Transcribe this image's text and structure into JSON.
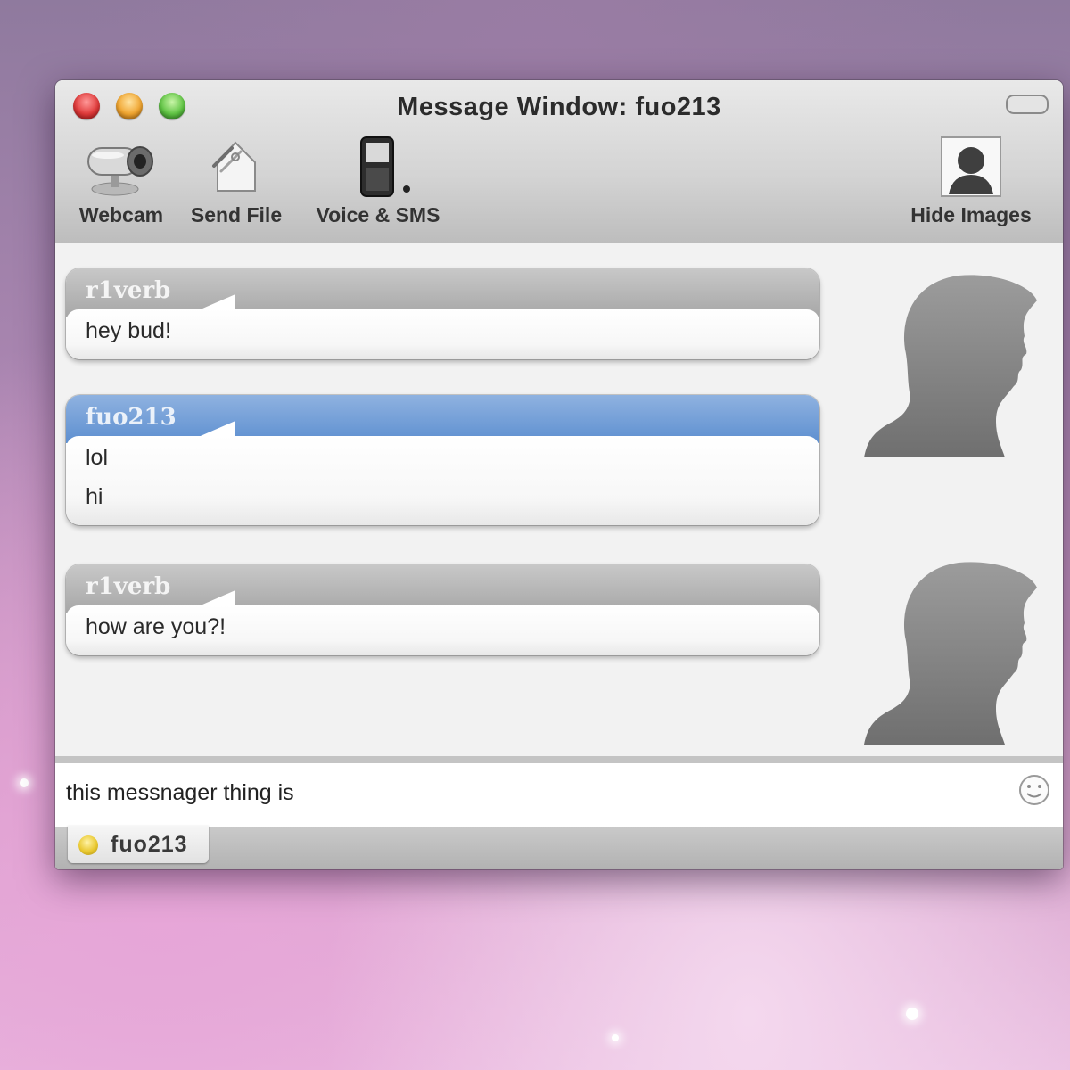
{
  "window": {
    "title": "Message Window: fuo213"
  },
  "toolbar": {
    "webcam": {
      "label": "Webcam",
      "icon": "webcam-icon"
    },
    "send_file": {
      "label": "Send File",
      "icon": "send-file-icon"
    },
    "voice_sms": {
      "label": "Voice & SMS",
      "icon": "phone-icon"
    },
    "hide_images": {
      "label": "Hide Images",
      "icon": "buddy-image-icon"
    }
  },
  "messages": [
    {
      "sender": "r1verb",
      "style": "gray",
      "lines": [
        "hey bud!"
      ]
    },
    {
      "sender": "fuo213",
      "style": "blue",
      "lines": [
        "lol",
        "hi"
      ]
    },
    {
      "sender": "r1verb",
      "style": "gray",
      "lines": [
        "how are you?!"
      ]
    }
  ],
  "composer": {
    "value": "this messnager thing is"
  },
  "tabs": [
    {
      "label": "fuo213",
      "status": "available"
    }
  ],
  "colors": {
    "bubble_gray": "#a7a7a7",
    "bubble_blue": "#5d8fd0",
    "status_available": "#e9c830"
  }
}
